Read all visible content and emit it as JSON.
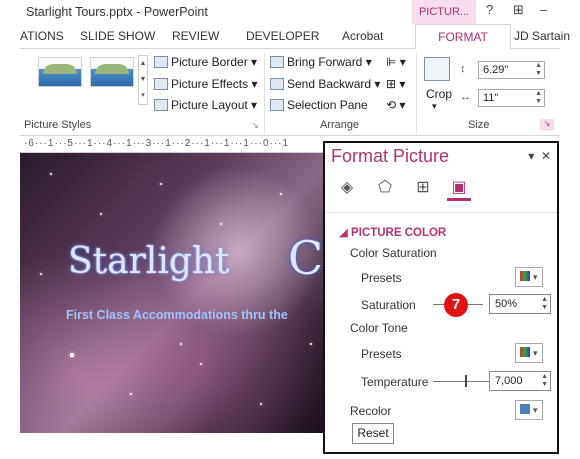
{
  "window": {
    "title": "Starlight Tours.pptx - PowerPoint",
    "context_tab": "PICTUR...",
    "help": "?",
    "restore": "⊞",
    "minimize": "–"
  },
  "tabs": [
    "ATIONS",
    "SLIDE SHOW",
    "REVIEW",
    "DEVELOPER",
    "Acrobat",
    "FORMAT",
    "JD Sartain"
  ],
  "ribbon": {
    "picture_border": "Picture Border",
    "picture_effects": "Picture Effects",
    "picture_layout": "Picture Layout",
    "bring_forward": "Bring Forward",
    "send_backward": "Send Backward",
    "selection_pane": "Selection Pane",
    "crop": "Crop",
    "height": "6.29\"",
    "width": "11\"",
    "groups": {
      "styles": "Picture Styles",
      "arrange": "Arrange",
      "size": "Size"
    }
  },
  "ruler": "·6···1···5···1···4···1···3···1···2···1···1···1···0···1",
  "slide": {
    "logo": "Starlight",
    "logo_right": "C",
    "tagline": "First Class Accommodations thru the"
  },
  "pane": {
    "title": "Format Picture",
    "pin": "▾",
    "close": "✕",
    "section": "PICTURE COLOR",
    "color_saturation": "Color Saturation",
    "presets": "Presets",
    "saturation": "Saturation",
    "saturation_value": "50%",
    "color_tone": "Color Tone",
    "presets2": "Presets",
    "temperature": "Temperature",
    "temperature_value": "7,000",
    "recolor": "Recolor",
    "reset": "Reset",
    "step_badge": "7",
    "saturation_fraction": 0.5
  },
  "colors": {
    "accent": "#b2316f",
    "badge": "#e01212"
  }
}
